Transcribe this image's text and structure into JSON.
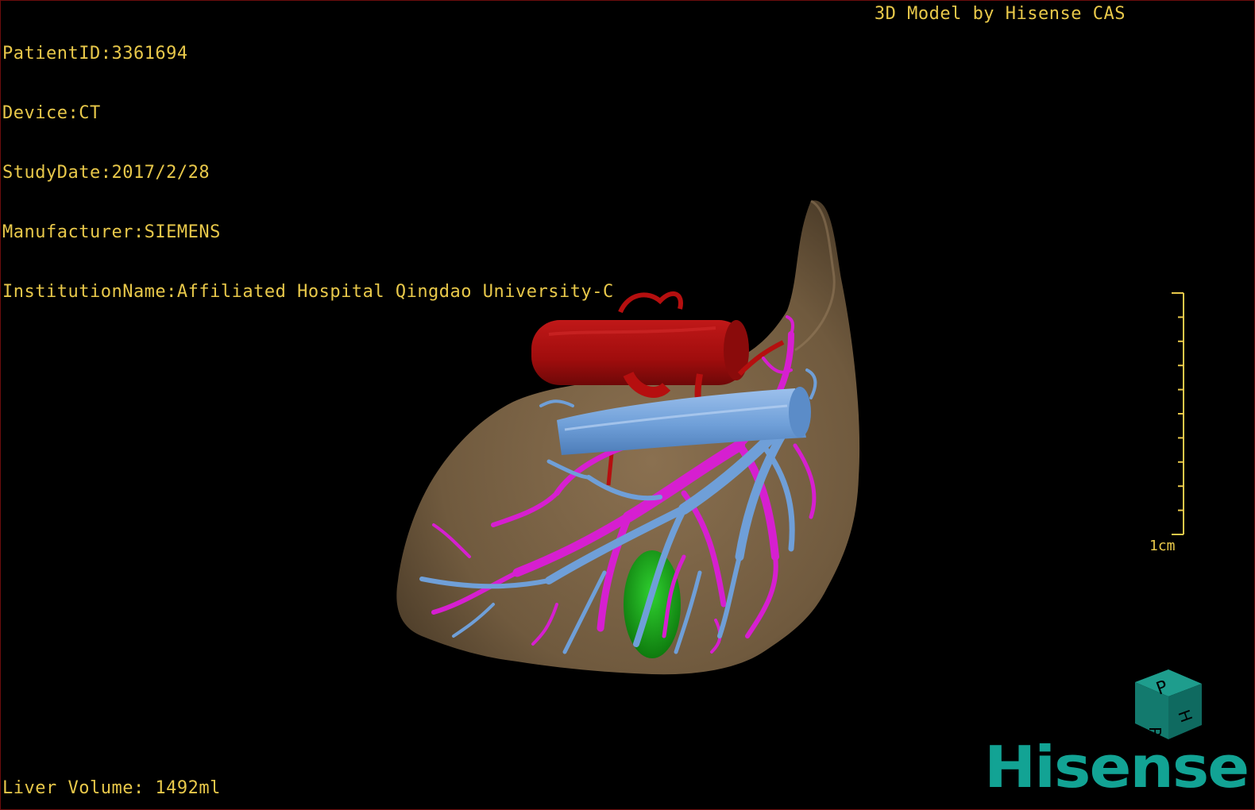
{
  "header": {
    "patient_id": "PatientID:3361694",
    "device": "Device:CT",
    "study_date": "StudyDate:2017/2/28",
    "manufacturer": "Manufacturer:SIEMENS",
    "institution": "InstitutionName:Affiliated Hospital Qingdao University-C"
  },
  "credit": "3D Model by Hisense CAS",
  "scale": {
    "label": "1cm",
    "ticks": 10
  },
  "footer": {
    "liver_volume": "Liver Volume: 1492ml"
  },
  "orientation_cube": {
    "faces": [
      "P",
      "H",
      "R"
    ]
  },
  "brand": "Hisense",
  "colors": {
    "overlay_text": "#e8c84a",
    "liver": "#7d6547",
    "artery": "#b50f0f",
    "portal_vein": "#d61fd0",
    "hepatic_vein": "#6f9fd8",
    "gallbladder": "#1a9a1a",
    "brand": "#12a394"
  }
}
